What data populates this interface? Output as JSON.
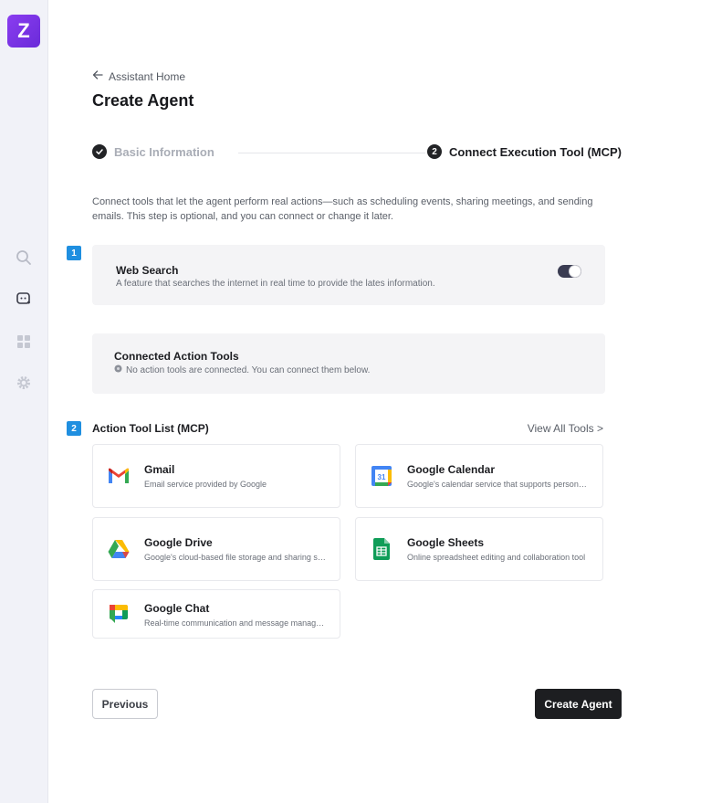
{
  "sidebar": {
    "logo_letter": "Z",
    "items": [
      {
        "name": "search-icon"
      },
      {
        "name": "agent-icon"
      },
      {
        "name": "grid-icon"
      },
      {
        "name": "gear-icon"
      }
    ]
  },
  "header": {
    "back_label": "Assistant Home",
    "title": "Create Agent"
  },
  "steps": [
    {
      "number": "1",
      "label": "Basic Information",
      "status": "completed"
    },
    {
      "number": "2",
      "label": "Connect Execution Tool (MCP)",
      "status": "active"
    }
  ],
  "description": "Connect tools that let the agent perform real actions—such as scheduling events, sharing meetings, and sending emails. This step is optional, and you can connect or change it later.",
  "section1": {
    "badge": "1",
    "web_search": {
      "title": "Web Search",
      "description": "A feature that searches the internet in real time to provide the lates information.",
      "enabled": true
    },
    "connected_tools": {
      "title": "Connected Action Tools",
      "empty_message": "No action tools are connected. You can connect them below."
    }
  },
  "section2": {
    "badge": "2",
    "title": "Action Tool List (MCP)",
    "view_all": "View All Tools >",
    "tools": [
      {
        "name": "Gmail",
        "description": "Email service provided by Google",
        "icon": "gmail-icon"
      },
      {
        "name": "Google Calendar",
        "description": "Google's calendar service that supports personal and...",
        "icon": "google-calendar-icon",
        "icon_text": "31"
      },
      {
        "name": "Google Drive",
        "description": "Google's cloud-based file storage and sharing service",
        "icon": "google-drive-icon"
      },
      {
        "name": "Google Sheets",
        "description": "Online spreadsheet editing and collaboration tool",
        "icon": "google-sheets-icon"
      },
      {
        "name": "Google Chat",
        "description": "Real-time communication and message management...",
        "icon": "google-chat-icon"
      }
    ]
  },
  "footer": {
    "previous_label": "Previous",
    "create_label": "Create Agent"
  },
  "colors": {
    "logo": "#7c3aed",
    "badge": "#1f8fe0",
    "primary_button": "#1d1e21"
  }
}
